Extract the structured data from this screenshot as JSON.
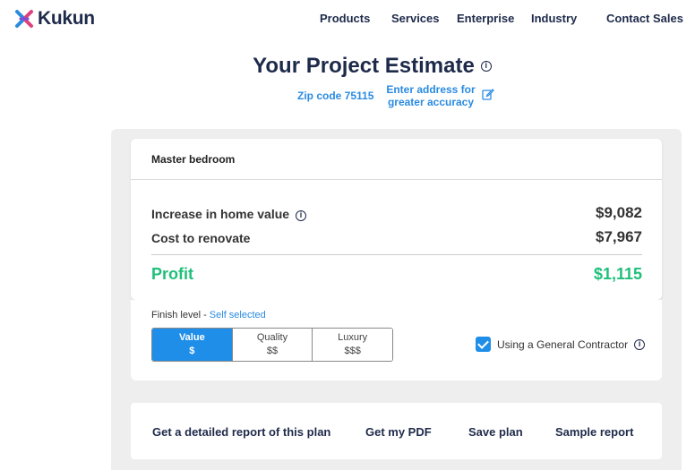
{
  "header": {
    "logo_text": "Kukun",
    "nav": [
      {
        "label": "Products"
      },
      {
        "label": "Services"
      },
      {
        "label": "Enterprise"
      },
      {
        "label": "Industry"
      },
      {
        "label": "Contact Sales"
      }
    ]
  },
  "estimate": {
    "title": "Your Project Estimate",
    "zip_label": "Zip code 75115",
    "enter_address": "Enter address for greater accuracy"
  },
  "summary": {
    "room": "Master bedroom",
    "increase_label": "Increase in home value",
    "increase_value": "$9,082",
    "cost_label": "Cost to renovate",
    "cost_value": "$7,967",
    "profit_label": "Profit",
    "profit_value": "$1,115"
  },
  "finish": {
    "label": "Finish level - ",
    "selected_text": "Self selected",
    "options": [
      {
        "name": "Value",
        "price": "$",
        "active": true
      },
      {
        "name": "Quality",
        "price": "$$",
        "active": false
      },
      {
        "name": "Luxury",
        "price": "$$$",
        "active": false
      }
    ],
    "contractor_label": "Using a General Contractor",
    "contractor_checked": true
  },
  "actions": [
    {
      "label": "Get a detailed report of this plan"
    },
    {
      "label": "Get my PDF"
    },
    {
      "label": "Save plan"
    },
    {
      "label": "Sample report"
    }
  ],
  "colors": {
    "accent": "#1f8ee8",
    "link": "#2a8be0",
    "profit": "#1fbf7a",
    "navy": "#1e2a4a"
  }
}
